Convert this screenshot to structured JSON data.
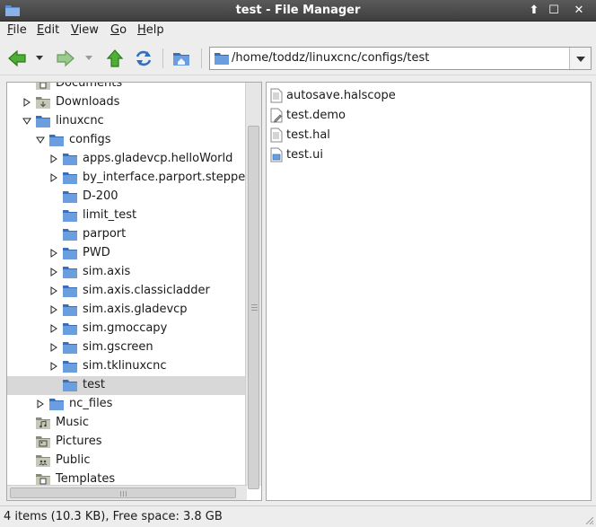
{
  "window": {
    "title": "test - File Manager",
    "up_button": "⬆",
    "maximize_button": "☐",
    "close_button": "✕"
  },
  "menu": [
    "File",
    "Edit",
    "View",
    "Go",
    "Help"
  ],
  "toolbar": {
    "icons": [
      "back-arrow-icon",
      "forward-arrow-icon",
      "up-arrow-icon",
      "refresh-icon",
      "home-folder-icon"
    ]
  },
  "location": {
    "path": "/home/toddz/linuxcnc/configs/test"
  },
  "tree": [
    {
      "label": "Documents",
      "icon": "documents-folder-icon",
      "expander": "none"
    },
    {
      "label": "Downloads",
      "icon": "downloads-folder-icon",
      "expander": "collapsed"
    },
    {
      "label": "linuxcnc",
      "icon": "folder-icon",
      "expander": "expanded"
    },
    {
      "label": "configs",
      "icon": "folder-icon",
      "expander": "expanded"
    },
    {
      "label": "apps.gladevcp.helloWorld",
      "icon": "folder-icon",
      "expander": "collapsed"
    },
    {
      "label": "by_interface.parport.stepper",
      "icon": "folder-icon",
      "expander": "collapsed"
    },
    {
      "label": "D-200",
      "icon": "folder-icon",
      "expander": "none"
    },
    {
      "label": "limit_test",
      "icon": "folder-icon",
      "expander": "none"
    },
    {
      "label": "parport",
      "icon": "folder-icon",
      "expander": "none"
    },
    {
      "label": "PWD",
      "icon": "folder-icon",
      "expander": "collapsed"
    },
    {
      "label": "sim.axis",
      "icon": "folder-icon",
      "expander": "collapsed"
    },
    {
      "label": "sim.axis.classicladder",
      "icon": "folder-icon",
      "expander": "collapsed"
    },
    {
      "label": "sim.axis.gladevcp",
      "icon": "folder-icon",
      "expander": "collapsed"
    },
    {
      "label": "sim.gmoccapy",
      "icon": "folder-icon",
      "expander": "collapsed"
    },
    {
      "label": "sim.gscreen",
      "icon": "folder-icon",
      "expander": "collapsed"
    },
    {
      "label": "sim.tklinuxcnc",
      "icon": "folder-icon",
      "expander": "collapsed"
    },
    {
      "label": "test",
      "icon": "folder-icon",
      "expander": "none",
      "selected": true
    },
    {
      "label": "nc_files",
      "icon": "folder-icon",
      "expander": "collapsed"
    },
    {
      "label": "Music",
      "icon": "music-folder-icon",
      "expander": "none"
    },
    {
      "label": "Pictures",
      "icon": "pictures-folder-icon",
      "expander": "none"
    },
    {
      "label": "Public",
      "icon": "public-folder-icon",
      "expander": "none"
    },
    {
      "label": "Templates",
      "icon": "templates-folder-icon",
      "expander": "none"
    }
  ],
  "files": [
    {
      "name": "autosave.halscope",
      "icon": "text-file-icon"
    },
    {
      "name": "test.demo",
      "icon": "script-file-icon"
    },
    {
      "name": "test.hal",
      "icon": "text-file-icon"
    },
    {
      "name": "test.ui",
      "icon": "ui-file-icon"
    }
  ],
  "status": {
    "text": "4 items (10.3 KB), Free space: 3.8 GB"
  },
  "colors": {
    "folder": "#5b8fd4",
    "folder_dark": "#3a6fb8",
    "arrow_green": "#3f9b2b",
    "selection": "#d8d8d8"
  }
}
